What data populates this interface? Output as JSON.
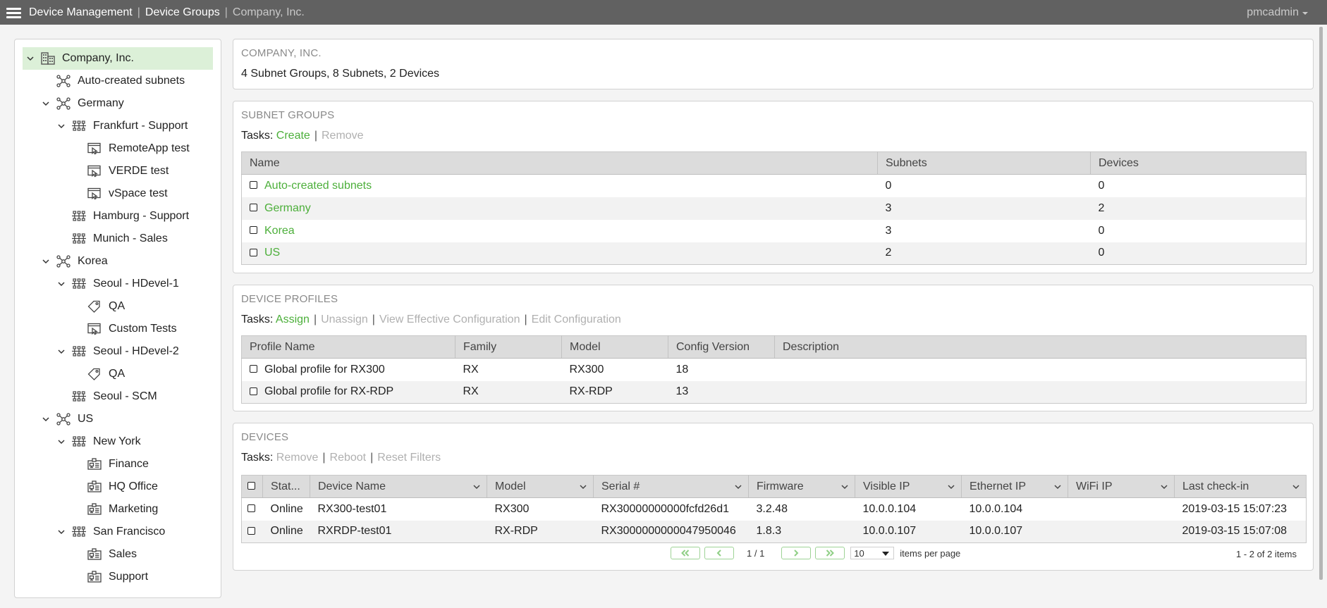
{
  "topbar": {
    "breadcrumbs": [
      "Device Management",
      "Device Groups",
      "Company, Inc."
    ],
    "separator": "|",
    "user": "pmcadmin"
  },
  "tree": [
    {
      "label": "Company, Inc.",
      "icon": "building-icon",
      "level": 0,
      "expanded": true,
      "selected": true
    },
    {
      "label": "Auto-created subnets",
      "icon": "subnet-group-icon",
      "level": 1,
      "expanded": null
    },
    {
      "label": "Germany",
      "icon": "subnet-group-icon",
      "level": 1,
      "expanded": true
    },
    {
      "label": "Frankfurt - Support",
      "icon": "subnet-icon",
      "level": 2,
      "expanded": true
    },
    {
      "label": "RemoteApp test",
      "icon": "remote-app-icon",
      "level": 3
    },
    {
      "label": "VERDE test",
      "icon": "remote-app-icon",
      "level": 3
    },
    {
      "label": "vSpace test",
      "icon": "remote-app-icon",
      "level": 3
    },
    {
      "label": "Hamburg - Support",
      "icon": "subnet-icon",
      "level": 2,
      "expanded": null
    },
    {
      "label": "Munich - Sales",
      "icon": "subnet-icon",
      "level": 2,
      "expanded": null
    },
    {
      "label": "Korea",
      "icon": "subnet-group-icon",
      "level": 1,
      "expanded": true
    },
    {
      "label": "Seoul - HDevel-1",
      "icon": "subnet-icon",
      "level": 2,
      "expanded": true
    },
    {
      "label": "QA",
      "icon": "tag-icon",
      "level": 3
    },
    {
      "label": "Custom Tests",
      "icon": "remote-app-icon",
      "level": 3
    },
    {
      "label": "Seoul - HDevel-2",
      "icon": "subnet-icon",
      "level": 2,
      "expanded": true
    },
    {
      "label": "QA",
      "icon": "tag-icon",
      "level": 3
    },
    {
      "label": "Seoul - SCM",
      "icon": "subnet-icon",
      "level": 2,
      "expanded": null
    },
    {
      "label": "US",
      "icon": "subnet-group-icon",
      "level": 1,
      "expanded": true
    },
    {
      "label": "New York",
      "icon": "subnet-icon",
      "level": 2,
      "expanded": true
    },
    {
      "label": "Finance",
      "icon": "device-group-icon",
      "level": 3
    },
    {
      "label": "HQ Office",
      "icon": "device-group-icon",
      "level": 3
    },
    {
      "label": "Marketing",
      "icon": "device-group-icon",
      "level": 3
    },
    {
      "label": "San Francisco",
      "icon": "subnet-icon",
      "level": 2,
      "expanded": true
    },
    {
      "label": "Sales",
      "icon": "device-group-icon",
      "level": 3
    },
    {
      "label": "Support",
      "icon": "device-group-icon",
      "level": 3
    }
  ],
  "company": {
    "title": "COMPANY, INC.",
    "summary": "4 Subnet Groups, 8 Subnets, 2 Devices"
  },
  "subnet_groups": {
    "title": "SUBNET GROUPS",
    "tasks_label": "Tasks:",
    "tasks": [
      {
        "label": "Create",
        "enabled": true
      },
      {
        "label": "Remove",
        "enabled": false
      }
    ],
    "columns": [
      "Name",
      "Subnets",
      "Devices"
    ],
    "rows": [
      {
        "name": "Auto-created subnets",
        "subnets": "0",
        "devices": "0"
      },
      {
        "name": "Germany",
        "subnets": "3",
        "devices": "2"
      },
      {
        "name": "Korea",
        "subnets": "3",
        "devices": "0"
      },
      {
        "name": "US",
        "subnets": "2",
        "devices": "0"
      }
    ]
  },
  "device_profiles": {
    "title": "DEVICE PROFILES",
    "tasks_label": "Tasks:",
    "tasks": [
      {
        "label": "Assign",
        "enabled": true
      },
      {
        "label": "Unassign",
        "enabled": false
      },
      {
        "label": "View Effective Configuration",
        "enabled": false
      },
      {
        "label": "Edit Configuration",
        "enabled": false
      }
    ],
    "columns": [
      "Profile Name",
      "Family",
      "Model",
      "Config Version",
      "Description"
    ],
    "rows": [
      {
        "profile_name": "Global profile for RX300",
        "family": "RX",
        "model": "RX300",
        "config_version": "18",
        "description": ""
      },
      {
        "profile_name": "Global profile for RX-RDP",
        "family": "RX",
        "model": "RX-RDP",
        "config_version": "13",
        "description": ""
      }
    ]
  },
  "devices": {
    "title": "DEVICES",
    "tasks_label": "Tasks:",
    "tasks": [
      {
        "label": "Remove",
        "enabled": false
      },
      {
        "label": "Reboot",
        "enabled": false
      },
      {
        "label": "Reset Filters",
        "enabled": false
      }
    ],
    "columns": [
      "Stat...",
      "Device Name",
      "Model",
      "Serial #",
      "Firmware",
      "Visible IP",
      "Ethernet IP",
      "WiFi IP",
      "Last check-in"
    ],
    "rows": [
      {
        "status": "Online",
        "device_name": "RX300-test01",
        "model": "RX300",
        "serial": "RX30000000000fcfd26d1",
        "firmware": "3.2.48",
        "visible_ip": "10.0.0.104",
        "ethernet_ip": "10.0.0.104",
        "wifi_ip": "",
        "last_checkin": "2019-03-15 15:07:23"
      },
      {
        "status": "Online",
        "device_name": "RXRDP-test01",
        "model": "RX-RDP",
        "serial": "RX3000000000047950046",
        "firmware": "1.8.3",
        "visible_ip": "10.0.0.107",
        "ethernet_ip": "10.0.0.107",
        "wifi_ip": "",
        "last_checkin": "2019-03-15 15:07:08"
      }
    ],
    "pager": {
      "page_info": "1 / 1",
      "page_size": "10",
      "items_per_page_label": "items per page",
      "count_label": "1 - 2 of 2 items"
    }
  },
  "colors": {
    "topbar_bg": "#616161",
    "accent_green": "#4caf3a",
    "selected_bg": "#dcf0d8",
    "disabled_text": "#b0b0b0"
  }
}
